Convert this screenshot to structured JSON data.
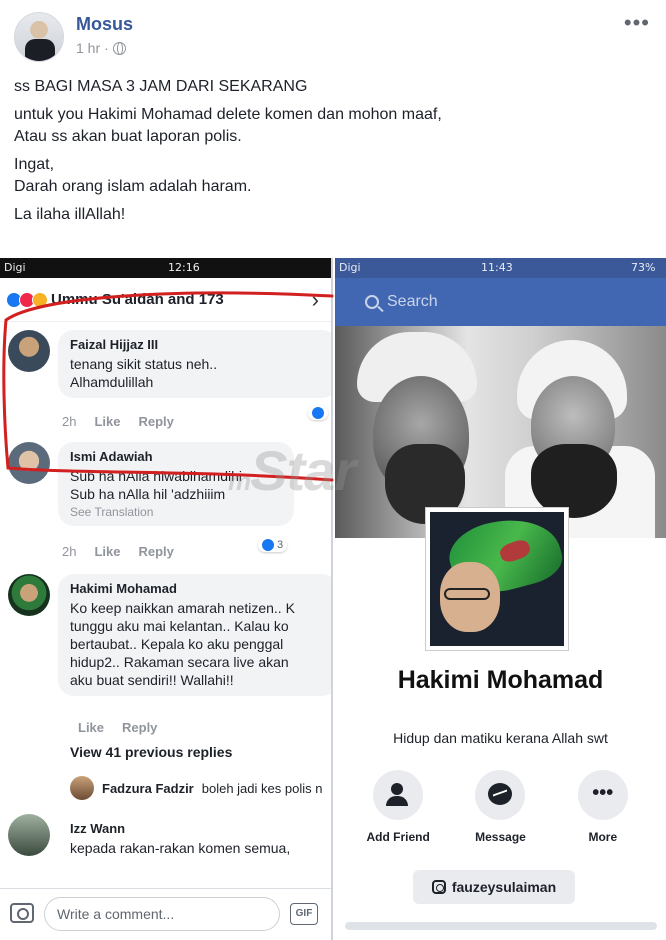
{
  "post": {
    "author": "Mosus",
    "time": "1 hr",
    "menu": "•••",
    "lines": [
      "ss BAGI MASA 3 JAM DARI SEKARANG",
      "untuk you Hakimi Mohamad delete komen dan mohon maaf,",
      "Atau ss akan buat laporan polis.",
      "Ingat,",
      "Darah orang islam adalah haram.",
      "La ilaha illAllah!"
    ]
  },
  "left_phone": {
    "status": {
      "carrier": "Digi",
      "time": "12:16"
    },
    "reactions_label": "Ummu Su'aidah and 173",
    "comments": [
      {
        "name": "Faizal Hijjaz III",
        "text": "tenang sikit status neh..\nAlhamdulillah",
        "age": "2h",
        "like": "Like",
        "reply": "Reply"
      },
      {
        "name": "Ismi Adawiah",
        "text": "Sub ha nAlla hiwabihamdihi\nSub ha nAlla hil 'adzhiiim",
        "translation": "See Translation",
        "age": "2h",
        "like": "Like",
        "reply": "Reply",
        "likes_count": "3"
      },
      {
        "name": "Hakimi Mohamad",
        "text": "Ko keep naikkan amarah netizen.. K\ntunggu aku mai kelantan.. Kalau ko\nbertaubat.. Kepala ko aku penggal\nhidup2.. Rakaman secara live akan\naku buat sendiri!! Wallahi!!",
        "like": "Like",
        "reply": "Reply"
      },
      {
        "name": "Izz Wann",
        "text": "kepada rakan-rakan komen semua,"
      }
    ],
    "view_replies": "View 41 previous replies",
    "reply_preview": {
      "name": "Fadzura Fadzir",
      "text": "boleh jadi kes polis n"
    },
    "write_placeholder": "Write a comment...",
    "gif_label": "GIF"
  },
  "right_phone": {
    "status": {
      "carrier": "Digi",
      "time": "11:43",
      "battery": "73%"
    },
    "search_label": "Search",
    "profile_name": "Hakimi Mohamad",
    "bio": "Hidup dan matiku kerana Allah swt",
    "actions": [
      {
        "label": "Add Friend",
        "icon": "add-friend-icon"
      },
      {
        "label": "Message",
        "icon": "messenger-icon"
      },
      {
        "label": "More",
        "icon": "more-icon"
      }
    ],
    "instagram": "fauzeysulaiman"
  },
  "watermark": "mStar",
  "colors": {
    "fb_blue": "#4267b2",
    "link_blue": "#365899",
    "annotation_red": "#d21f1f"
  }
}
